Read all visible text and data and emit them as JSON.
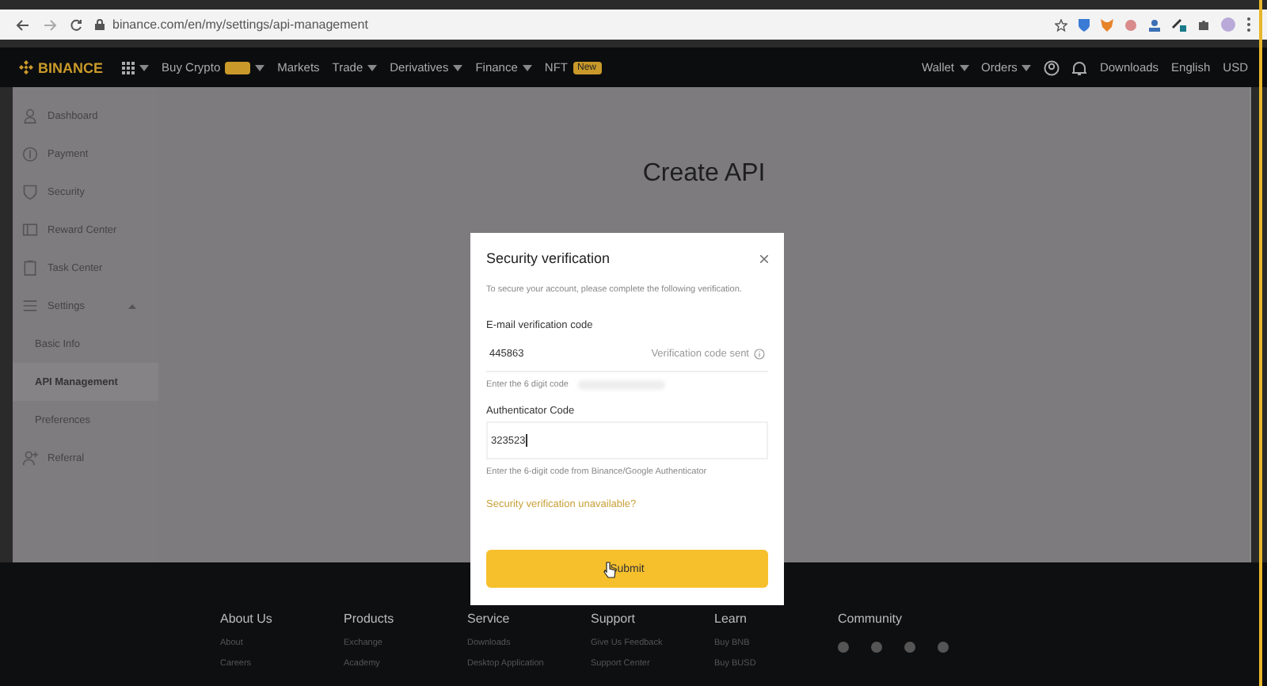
{
  "browser": {
    "url": "binance.com/en/my/settings/api-management"
  },
  "nav": {
    "logo": "BINANCE",
    "left": [
      {
        "label": "Buy Crypto",
        "dropdown": true,
        "tag": true
      },
      {
        "label": "Markets",
        "dropdown": false
      },
      {
        "label": "Trade",
        "dropdown": true
      },
      {
        "label": "Derivatives",
        "dropdown": true
      },
      {
        "label": "Finance",
        "dropdown": true
      },
      {
        "label": "NFT",
        "dropdown": false,
        "badge": "New"
      }
    ],
    "right": [
      {
        "label": "Wallet",
        "dropdown": true
      },
      {
        "label": "Orders",
        "dropdown": true
      }
    ],
    "links": [
      "Downloads",
      "English",
      "USD"
    ]
  },
  "sidebar": {
    "items": [
      {
        "label": "Dashboard",
        "selected": false
      },
      {
        "label": "Payment",
        "selected": false
      },
      {
        "label": "Security",
        "selected": false
      },
      {
        "label": "Reward Center",
        "selected": false
      },
      {
        "label": "Task Center",
        "selected": false
      },
      {
        "label": "Settings",
        "expanded": true,
        "selected": false,
        "children": [
          {
            "label": "Basic Info",
            "selected": false
          },
          {
            "label": "API Management",
            "selected": true
          },
          {
            "label": "Preferences",
            "selected": false
          }
        ]
      },
      {
        "label": "Referral",
        "selected": false
      }
    ]
  },
  "page": {
    "title": "Create API"
  },
  "modal": {
    "title": "Security verification",
    "intro": "To secure your account, please complete the following verification.",
    "fields": [
      {
        "label": "E-mail verification code",
        "value": "445863",
        "suffix": "Verification code sent",
        "hint": "Enter the 6 digit code",
        "focused": false
      },
      {
        "label": "Authenticator Code",
        "value": "323523",
        "hint": "Enter the 6-digit code from Binance/Google Authenticator",
        "focused": true
      }
    ],
    "link": "Security verification unavailable?",
    "submit": "Submit"
  },
  "footer": {
    "columns": [
      {
        "title": "About Us",
        "links": [
          "About",
          "Careers"
        ]
      },
      {
        "title": "Products",
        "links": [
          "Exchange",
          "Academy"
        ]
      },
      {
        "title": "Service",
        "links": [
          "Downloads",
          "Desktop Application"
        ]
      },
      {
        "title": "Support",
        "links": [
          "Give Us Feedback",
          "Support Center"
        ]
      },
      {
        "title": "Learn",
        "links": [
          "Buy BNB",
          "Buy BUSD"
        ]
      },
      {
        "title": "Community"
      }
    ]
  }
}
